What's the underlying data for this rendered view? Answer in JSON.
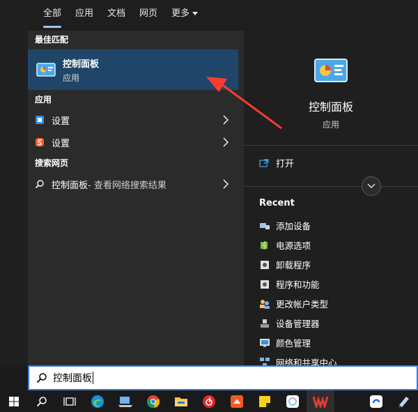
{
  "tabs": [
    {
      "label": "全部",
      "active": true
    },
    {
      "label": "应用",
      "active": false
    },
    {
      "label": "文档",
      "active": false
    },
    {
      "label": "网页",
      "active": false
    },
    {
      "label": "更多",
      "active": false
    }
  ],
  "left": {
    "best_match_title": "最佳匹配",
    "best_match": {
      "name": "控制面板",
      "type": "应用",
      "icon": "control-panel-icon"
    },
    "apps_title": "应用",
    "apps": [
      {
        "label": "设置",
        "icon": "settings-icon",
        "color": "#3a8ee6"
      },
      {
        "label": "设置",
        "icon": "sogou-settings-icon",
        "color": "#ff5a1f"
      }
    ],
    "web_title": "搜索网页",
    "web_result": {
      "query": "控制面板",
      "suffix": " - 查看网络搜索结果"
    }
  },
  "right": {
    "title": "控制面板",
    "subtitle": "应用",
    "open_label": "打开",
    "recent_title": "Recent",
    "recent": [
      {
        "label": "添加设备",
        "icon": "add-device-icon"
      },
      {
        "label": "电源选项",
        "icon": "power-options-icon"
      },
      {
        "label": "卸载程序",
        "icon": "uninstall-icon"
      },
      {
        "label": "程序和功能",
        "icon": "programs-icon"
      },
      {
        "label": "更改帐户类型",
        "icon": "users-icon"
      },
      {
        "label": "设备管理器",
        "icon": "device-manager-icon"
      },
      {
        "label": "颜色管理",
        "icon": "color-management-icon"
      },
      {
        "label": "网络和共享中心",
        "icon": "network-icon"
      }
    ]
  },
  "search": {
    "value": "控制面板"
  },
  "taskbar": [
    "windows-start-icon",
    "search-icon",
    "task-view-icon",
    "edge-icon",
    "computer-icon",
    "chrome-icon",
    "file-explorer-icon",
    "netease-music-icon",
    "presentation-icon",
    "sticky-notes-icon",
    "photos-icon",
    "wps-icon",
    "blank-icon",
    "browser-icon",
    "pen-icon"
  ],
  "colors": {
    "accent": "#1f4668",
    "arrow": "#ff3b30"
  }
}
